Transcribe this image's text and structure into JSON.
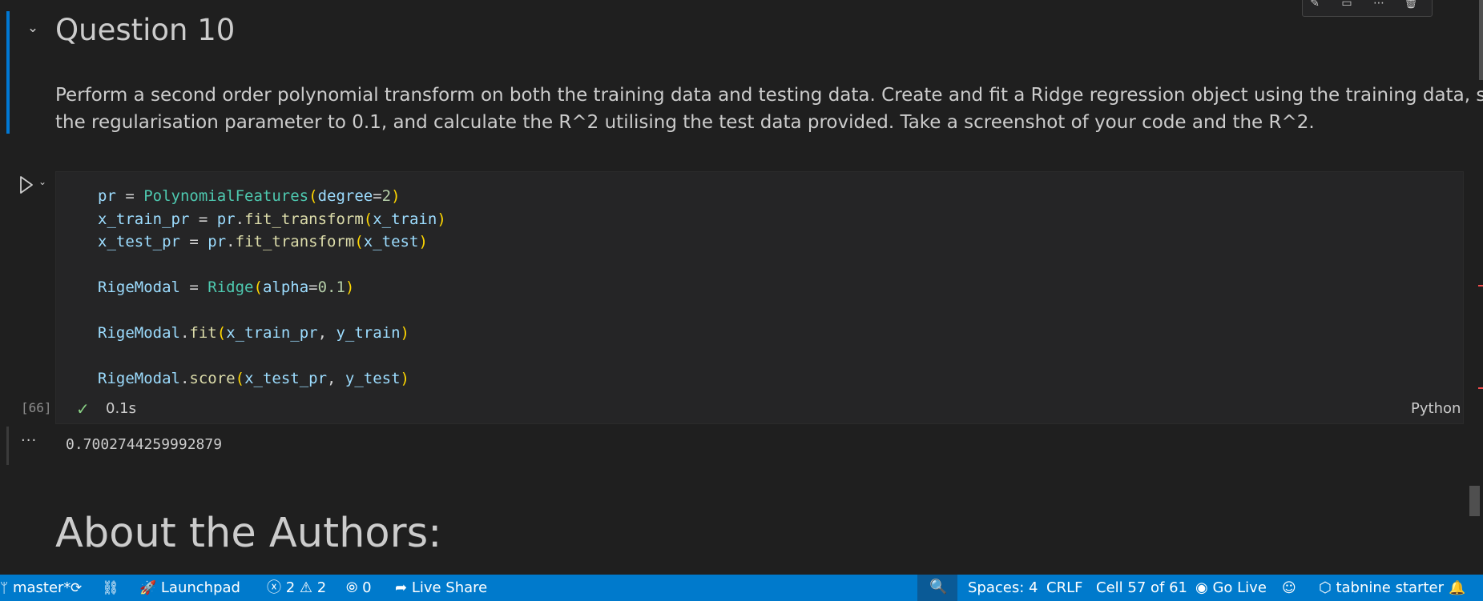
{
  "markdown_cell": {
    "heading": "Question 10",
    "text_line1": "Perform a second order polynomial transform on both the training data and testing data. Create and fit a Ridge regression object using the training data, set",
    "text_line2": "the regularisation parameter to 0.1, and calculate the R^2 utilising the test data provided. Take a screenshot of your code and the R^2."
  },
  "code_cell": {
    "lines": [
      [
        "pr",
        " = ",
        "PolynomialFeatures",
        "(",
        "degree",
        "=",
        "2",
        ")"
      ],
      [
        "x_train_pr",
        " = ",
        "pr",
        ".",
        "fit_transform",
        "(",
        "x_train",
        ")"
      ],
      [
        "x_test_pr",
        " = ",
        "pr",
        ".",
        "fit_transform",
        "(",
        "x_test",
        ")"
      ],
      [
        "RigeModal",
        " = ",
        "Ridge",
        "(",
        "alpha",
        "=",
        "0.1",
        ")"
      ],
      [
        "RigeModal",
        ".",
        "fit",
        "(",
        "x_train_pr",
        ", ",
        "y_train",
        ")"
      ],
      [
        "RigeModal",
        ".",
        "score",
        "(",
        "x_test_pr",
        ", ",
        "y_test",
        ")"
      ]
    ],
    "execution_count": "[66]",
    "exec_time": "0.1s",
    "language": "Python"
  },
  "output": {
    "more": "···",
    "value": "0.7002744259992879"
  },
  "next_heading": "About the Authors:",
  "status_bar": {
    "branch": "master*",
    "launchpad": "Launchpad",
    "errors": "2",
    "warnings": "2",
    "ports": "0",
    "live_share": "Live Share",
    "spaces": "Spaces: 4",
    "eol": "CRLF",
    "cell_position": "Cell 57 of 61",
    "go_live": "Go Live",
    "tabnine": "tabnine starter"
  },
  "colors": {
    "accent": "#007acc",
    "success": "#89d185",
    "background": "#1f1f1f"
  }
}
